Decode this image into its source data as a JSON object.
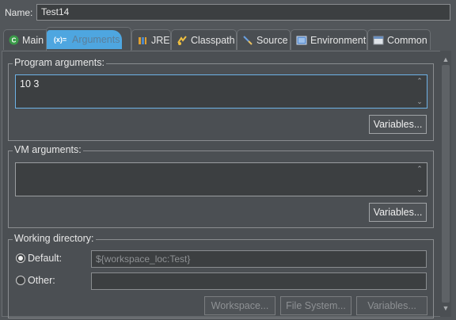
{
  "name_field": {
    "label": "Name:",
    "value": "Test14"
  },
  "tabs": [
    {
      "label": "Main",
      "icon": "main-class-icon"
    },
    {
      "label": "Arguments",
      "icon": "arguments-icon",
      "icon_text": "(x)="
    },
    {
      "label": "JRE",
      "icon": "jre-icon"
    },
    {
      "label": "Classpath",
      "icon": "classpath-icon"
    },
    {
      "label": "Source",
      "icon": "source-icon"
    },
    {
      "label": "Environment",
      "icon": "environment-icon"
    },
    {
      "label": "Common",
      "icon": "common-icon"
    }
  ],
  "program_arguments": {
    "title": "Program arguments:",
    "value": "10 3",
    "variables_button": "Variables..."
  },
  "vm_arguments": {
    "title": "VM arguments:",
    "value": "",
    "variables_button": "Variables..."
  },
  "working_directory": {
    "title": "Working directory:",
    "default_label": "Default:",
    "default_value": "${workspace_loc:Test}",
    "other_label": "Other:",
    "other_value": "",
    "selected": "Default",
    "buttons": {
      "workspace": "Workspace...",
      "file_system": "File System...",
      "variables": "Variables..."
    }
  },
  "colors": {
    "background": "#52565a",
    "active_tab_highlight": "#4ea6e0",
    "field_bg": "#3c3f41"
  }
}
